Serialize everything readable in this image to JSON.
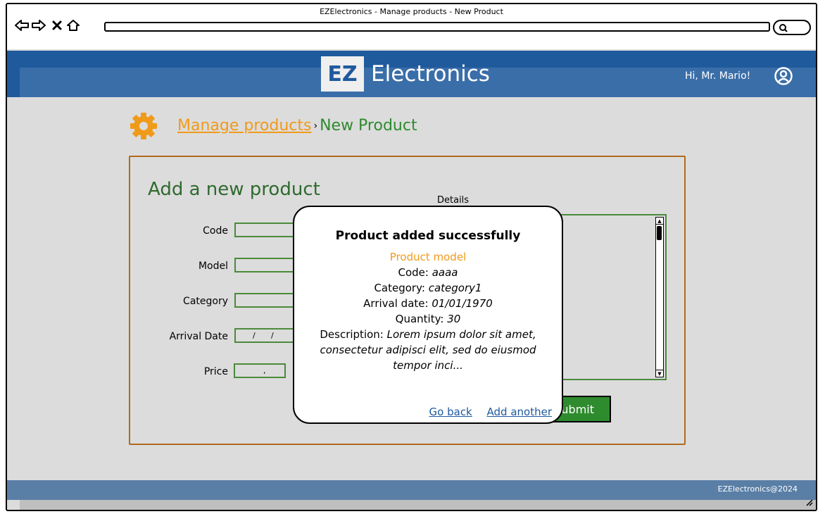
{
  "window": {
    "title": "EZElectronics - Manage products - New Product"
  },
  "header": {
    "logo_mark": "EZ",
    "logo_text": "Electronics",
    "greeting": "Hi, Mr. Mario!"
  },
  "breadcrumb": {
    "parent": "Manage products",
    "separator": "›",
    "current": "New Product"
  },
  "form": {
    "title": "Add a new product",
    "details_label": "Details",
    "fields": {
      "code": "Code",
      "model": "Model",
      "category": "Category",
      "arrival_date": "Arrival Date",
      "price": "Price"
    },
    "date_sep": "/",
    "price_sep": ",",
    "submit_label": "Submit"
  },
  "modal": {
    "title": "Product added successfully",
    "model": "Product model",
    "code_label": "Code:",
    "code_value": "aaaa",
    "category_label": "Category:",
    "category_value": "category1",
    "arrival_label": "Arrival date:",
    "arrival_value": "01/01/1970",
    "quantity_label": "Quantity:",
    "quantity_value": "30",
    "description_label": "Description:",
    "description_value": "Lorem ipsum dolor sit amet, consectetur adipisci elit, sed do eiusmod tempor inci...",
    "go_back": "Go back",
    "add_another": "Add another"
  },
  "footer": {
    "text": "EZElectronics@2024"
  },
  "colors": {
    "header": "#1f5a9d",
    "accent_orange": "#f09a1a",
    "accent_green": "#2e8b2e",
    "link_blue": "#1f5a9d"
  }
}
